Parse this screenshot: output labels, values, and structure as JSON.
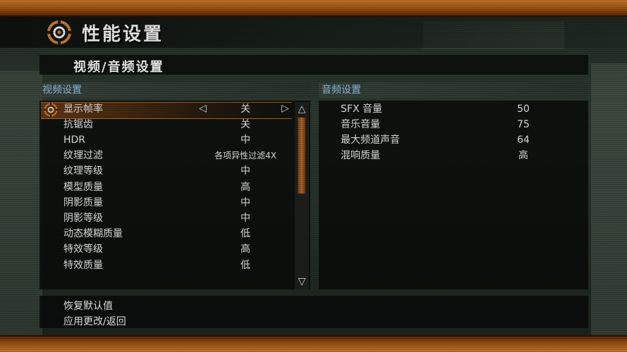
{
  "header": {
    "title": "性能设置"
  },
  "section": {
    "title": "视频/音频设置"
  },
  "video": {
    "heading": "视频设置",
    "selected_index": 0,
    "items": [
      {
        "label": "显示帧率",
        "value": "关"
      },
      {
        "label": "抗锯齿",
        "value": "关"
      },
      {
        "label": "HDR",
        "value": "中"
      },
      {
        "label": "纹理过滤",
        "value": "各项异性过滤4X"
      },
      {
        "label": "纹理等级",
        "value": "中"
      },
      {
        "label": "模型质量",
        "value": "高"
      },
      {
        "label": "阴影质量",
        "value": "中"
      },
      {
        "label": "阴影等级",
        "value": "中"
      },
      {
        "label": "动态模糊质量",
        "value": "低"
      },
      {
        "label": "特效等级",
        "value": "高"
      },
      {
        "label": "特效质量",
        "value": "低"
      }
    ],
    "arrow_left": "◁",
    "arrow_right": "▷",
    "scroll_up": "△",
    "scroll_down": "▽"
  },
  "audio": {
    "heading": "音频设置",
    "items": [
      {
        "label": "SFX 音量",
        "value": "50"
      },
      {
        "label": "音乐音量",
        "value": "75"
      },
      {
        "label": "最大频道声音",
        "value": "64"
      },
      {
        "label": "混响质量",
        "value": "高"
      }
    ]
  },
  "footer": {
    "restore": "恢复默认值",
    "apply": "应用更改/返回"
  },
  "colors": {
    "accent": "#b8661e",
    "heading": "#8fc4e8",
    "bar": "#c97a2a"
  }
}
